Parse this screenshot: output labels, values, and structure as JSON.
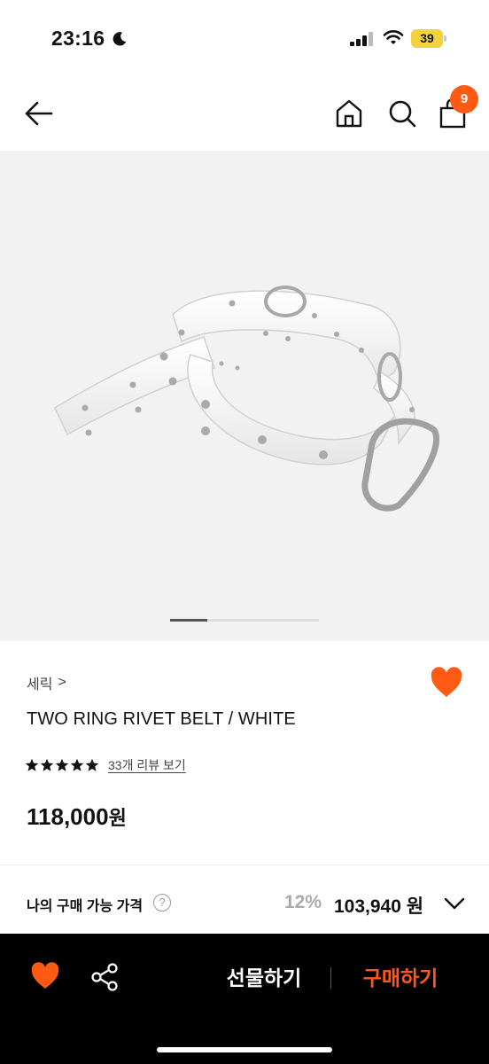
{
  "status_bar": {
    "time": "23:16",
    "battery": "39",
    "icons": [
      "moon-icon",
      "signal-icon",
      "wifi-icon",
      "battery-icon"
    ]
  },
  "header": {
    "icons": [
      "back-arrow-icon",
      "home-icon",
      "search-icon",
      "shopping-bag-icon"
    ],
    "cart_count": "9"
  },
  "gallery": {
    "current_page": 1,
    "total_pages": 4
  },
  "product": {
    "brand": "세릭",
    "brand_chevron": ">",
    "name": "TWO RING RIVET BELT / WHITE",
    "rating_stars": 5,
    "review_link": "33개 리뷰 보기",
    "price": "118,000",
    "price_unit": "원",
    "wishlisted": true
  },
  "my_price": {
    "label": "나의 구매 가능 가격",
    "help": "?",
    "discount": "12%",
    "price": "103,940 원"
  },
  "bottom_bar": {
    "gift_label": "선물하기",
    "buy_label": "구매하기"
  },
  "colors": {
    "accent": "#ff5a14",
    "bottom_bar_bg": "#000000",
    "gallery_bg": "#f2f2f2"
  }
}
